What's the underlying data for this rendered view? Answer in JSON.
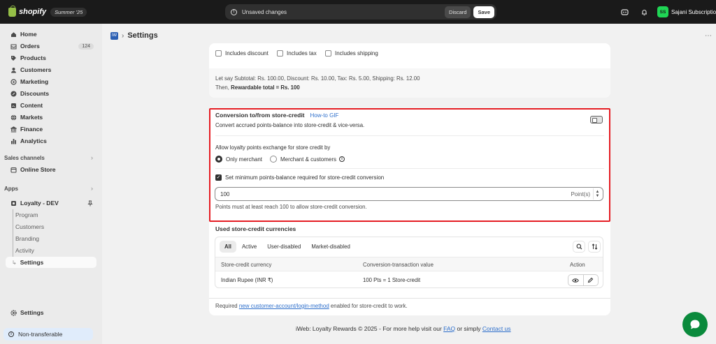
{
  "topbar": {
    "brand": "shopify",
    "edition": "Summer '25",
    "unsaved_text": "Unsaved changes",
    "discard_label": "Discard",
    "save_label": "Save",
    "avatar_initials": "SS",
    "store_name": "Sajani Subscription"
  },
  "sidebar": {
    "items": [
      {
        "label": "Home",
        "icon": "home-icon"
      },
      {
        "label": "Orders",
        "icon": "orders-icon",
        "badge": "124"
      },
      {
        "label": "Products",
        "icon": "tag-icon"
      },
      {
        "label": "Customers",
        "icon": "person-icon"
      },
      {
        "label": "Marketing",
        "icon": "target-icon"
      },
      {
        "label": "Discounts",
        "icon": "discount-icon"
      },
      {
        "label": "Content",
        "icon": "content-icon"
      },
      {
        "label": "Markets",
        "icon": "globe-icon"
      },
      {
        "label": "Finance",
        "icon": "bank-icon"
      },
      {
        "label": "Analytics",
        "icon": "chart-icon"
      }
    ],
    "sales_channels_title": "Sales channels",
    "online_store_label": "Online Store",
    "apps_title": "Apps",
    "app_name": "Loyalty - DEV",
    "app_sub_items": [
      "Program",
      "Customers",
      "Branding",
      "Activity",
      "Settings"
    ],
    "settings_label": "Settings",
    "non_transferable_label": "Non-transferable"
  },
  "page": {
    "title": "Settings",
    "app_logo_text": "iW"
  },
  "reward_card": {
    "checkboxes": [
      "Includes discount",
      "Includes tax",
      "Includes shipping"
    ],
    "example_line1": "Let say Subtotal: Rs. 100.00, Discount: Rs. 10.00, Tax: Rs. 5.00, Shipping: Rs. 12.00",
    "example_line2_prefix": "Then, ",
    "example_line2_bold": "Rewardable total = Rs. 100"
  },
  "conversion": {
    "title": "Conversion to/from store-credit",
    "howto_link": "How-to GIF",
    "description": "Convert accrued points-balance into store-credit & vice-versa.",
    "exchange_label": "Allow loyalty points exchange for store credit by",
    "radio_options": [
      "Only merchant",
      "Merchant & customers"
    ],
    "min_balance_label": "Set minimum points-balance required for store-credit conversion",
    "min_balance_value": "100",
    "min_balance_suffix": "Point(s)",
    "help_text": "Points must at least reach 100 to allow store-credit conversion."
  },
  "currencies": {
    "title": "Used store-credit currencies",
    "tabs": [
      "All",
      "Active",
      "User-disabled",
      "Market-disabled"
    ],
    "columns": [
      "Store-credit currency",
      "Conversion-transaction value",
      "Action"
    ],
    "rows": [
      {
        "currency": "Indian Rupee (INR ₹)",
        "value": "100 Pts = 1 Store-credit"
      }
    ],
    "required_prefix": "Required ",
    "required_link": "new customer-account/login-method",
    "required_suffix": " enabled for store-credit to work."
  },
  "footer": {
    "prefix": "iWeb: Loyalty Rewards © 2025 - For more help visit our ",
    "faq_link": "FAQ",
    "middle": " or simply ",
    "contact_link": "Contact us"
  }
}
